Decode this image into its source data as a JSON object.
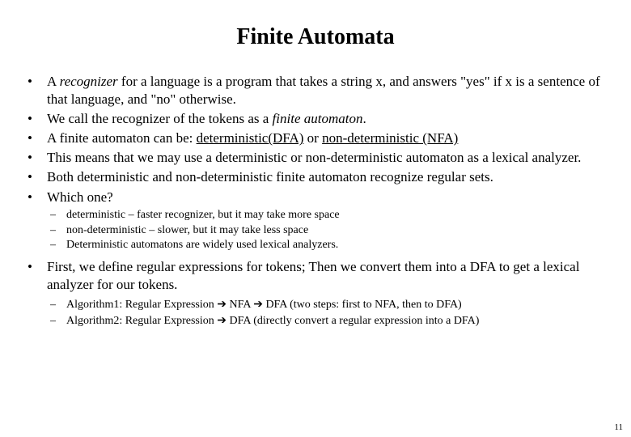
{
  "title": "Finite Automata",
  "bullets": {
    "b1_a": "A ",
    "b1_recognizer": "recognizer",
    "b1_b": " for a language is a program that takes a string x, and answers \"yes\" if x is a sentence of that language, and \"no\" otherwise.",
    "b2_a": "We call the recognizer of the tokens as a ",
    "b2_fa": "finite automaton",
    "b2_b": ".",
    "b3_a": "A finite automaton can be: ",
    "b3_dfa": "deterministic(DFA)",
    "b3_or": " or ",
    "b3_nfa": "non-deterministic (NFA)",
    "b4": "This means that we may use a deterministic or non-deterministic automaton as a lexical analyzer.",
    "b5": "Both deterministic and non-deterministic finite automaton recognize regular sets.",
    "b6": "Which one?",
    "b7": "First, we define regular expressions for tokens; Then we convert them into a DFA to get a lexical analyzer for our tokens."
  },
  "sub1": {
    "s1": "deterministic – faster recognizer, but it may take more space",
    "s2": "non-deterministic – slower, but it may take less space",
    "s3": "Deterministic automatons are widely used lexical analyzers."
  },
  "sub2": {
    "s1_a": "Algorithm1:  Regular Expression  ",
    "arrow": "➔",
    "s1_b": " NFA ",
    "s1_c": " DFA  (two steps: first to NFA, then to DFA)",
    "s2_a": "Algorithm2:  Regular Expression ",
    "s2_b": " DFA   (directly convert a regular expression into a DFA)"
  },
  "pageNumber": "11"
}
